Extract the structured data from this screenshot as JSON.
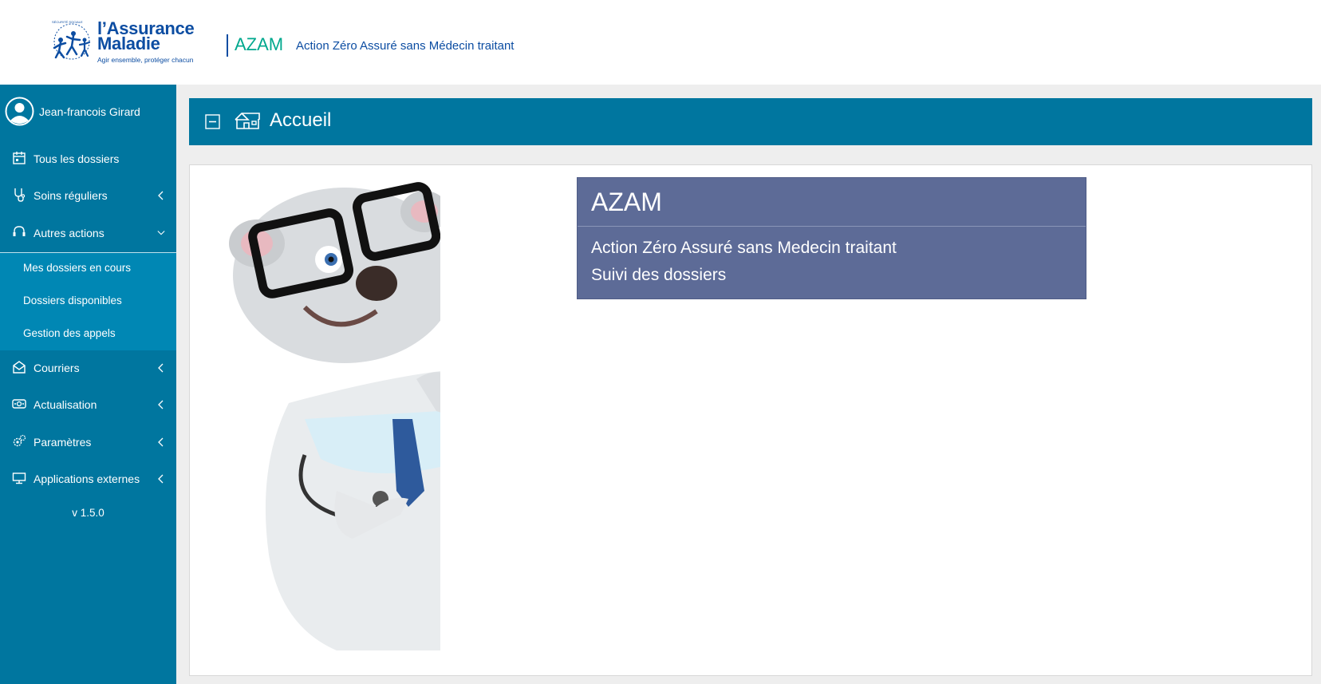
{
  "header": {
    "logo_name_line1": "l’Assurance",
    "logo_name_line2": "Maladie",
    "logo_tagline": "Agir ensemble, protéger chacun",
    "logo_arc_text": "SÉCURITÉ SOCIALE",
    "app_name": "AZAM",
    "app_subtitle": "Action Zéro Assuré sans Médecin traitant"
  },
  "sidebar": {
    "user_name": "Jean-francois Girard",
    "items": [
      {
        "label": "Tous les dossiers",
        "icon": "calendar-icon"
      },
      {
        "label": "Soins réguliers",
        "icon": "stethoscope-icon"
      },
      {
        "label": "Autres actions",
        "icon": "headset-icon",
        "expanded": true
      },
      {
        "label": "Courriers",
        "icon": "envelope-icon"
      },
      {
        "label": "Actualisation",
        "icon": "refresh-icon"
      },
      {
        "label": "Paramètres",
        "icon": "gears-icon"
      },
      {
        "label": "Applications externes",
        "icon": "monitor-icon"
      }
    ],
    "submenu": [
      {
        "label": "Mes dossiers en cours"
      },
      {
        "label": "Dossiers disponibles"
      },
      {
        "label": "Gestion des appels"
      }
    ],
    "version": "v 1.5.0"
  },
  "page": {
    "title": "Accueil"
  },
  "infobox": {
    "title": "AZAM",
    "line1": "Action Zéro Assuré sans Medecin traitant",
    "line2": "Suivi des dossiers"
  },
  "colors": {
    "brand_blue": "#0c4da2",
    "brand_green": "#00a88e",
    "sidebar": "#00769f",
    "submenu": "#0087b4",
    "infobox": "#5d6b97"
  }
}
